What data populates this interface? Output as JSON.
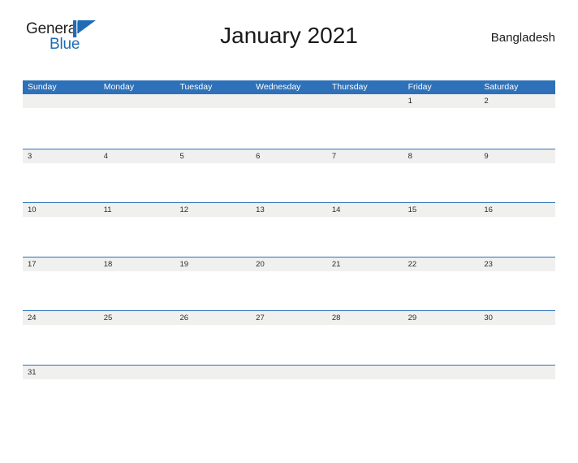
{
  "brand": {
    "word_general": "General",
    "word_blue": "Blue",
    "mark": "blue-flag-triangle",
    "colors": {
      "blue": "#1f6cb4",
      "dark": "#231f20"
    }
  },
  "header": {
    "title": "January 2021",
    "country": "Bangladesh"
  },
  "calendar": {
    "colors": {
      "header_blue": "#2e71b8",
      "row_strip_gray": "#f0f0ee",
      "separator_blue": "#2e71b8",
      "day_text": "#2b2b2b",
      "dow_text": "#ffffff"
    },
    "day_headers": [
      "Sunday",
      "Monday",
      "Tuesday",
      "Wednesday",
      "Thursday",
      "Friday",
      "Saturday"
    ],
    "weeks": [
      [
        "",
        "",
        "",
        "",
        "",
        "1",
        "2"
      ],
      [
        "3",
        "4",
        "5",
        "6",
        "7",
        "8",
        "9"
      ],
      [
        "10",
        "11",
        "12",
        "13",
        "14",
        "15",
        "16"
      ],
      [
        "17",
        "18",
        "19",
        "20",
        "21",
        "22",
        "23"
      ],
      [
        "24",
        "25",
        "26",
        "27",
        "28",
        "29",
        "30"
      ],
      [
        "31",
        "",
        "",
        "",
        "",
        "",
        ""
      ]
    ]
  }
}
